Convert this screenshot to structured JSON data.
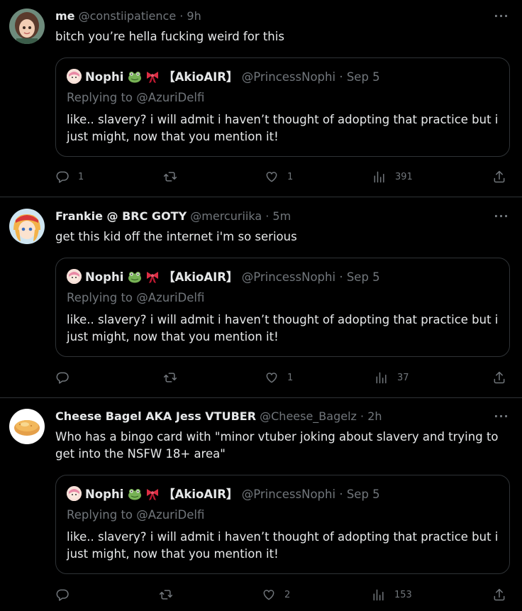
{
  "tweets": [
    {
      "name": "me",
      "handle": "@constiipatience",
      "time": "9h",
      "text": "bitch you’re hella fucking weird for this",
      "counts": {
        "reply": "1",
        "retweet": "",
        "like": "1",
        "views": "391"
      }
    },
    {
      "name": "Frankie @ BRC GOTY",
      "handle": "@mercuriika",
      "time": "5m",
      "text": "get this kid off the internet i'm so serious",
      "counts": {
        "reply": "",
        "retweet": "",
        "like": "1",
        "views": "37"
      }
    },
    {
      "name": "Cheese Bagel AKA Jess VTUBER",
      "handle": "@Cheese_Bagelz",
      "time": "2h",
      "text": "Who has a bingo card with \"minor vtuber joking about slavery and trying to get into the NSFW 18+ area\"",
      "counts": {
        "reply": "",
        "retweet": "",
        "like": "2",
        "views": "153"
      }
    }
  ],
  "quote": {
    "name_prefix": "Nophi",
    "name_suffix": "【AkioAIR】",
    "handle": "@PrincessNophi",
    "time": "Sep 5",
    "replying_label": "Replying to",
    "replying_handle": "@AzuriDelfi",
    "text": "like.. slavery? i will admit i haven’t thought of adopting that practice but i just might, now that you mention it!"
  },
  "separator": " · ",
  "icons": [
    "reply-icon",
    "retweet-icon",
    "like-icon",
    "views-icon",
    "share-icon",
    "more-icon",
    "frog-emoji",
    "ribbon-emoji"
  ]
}
